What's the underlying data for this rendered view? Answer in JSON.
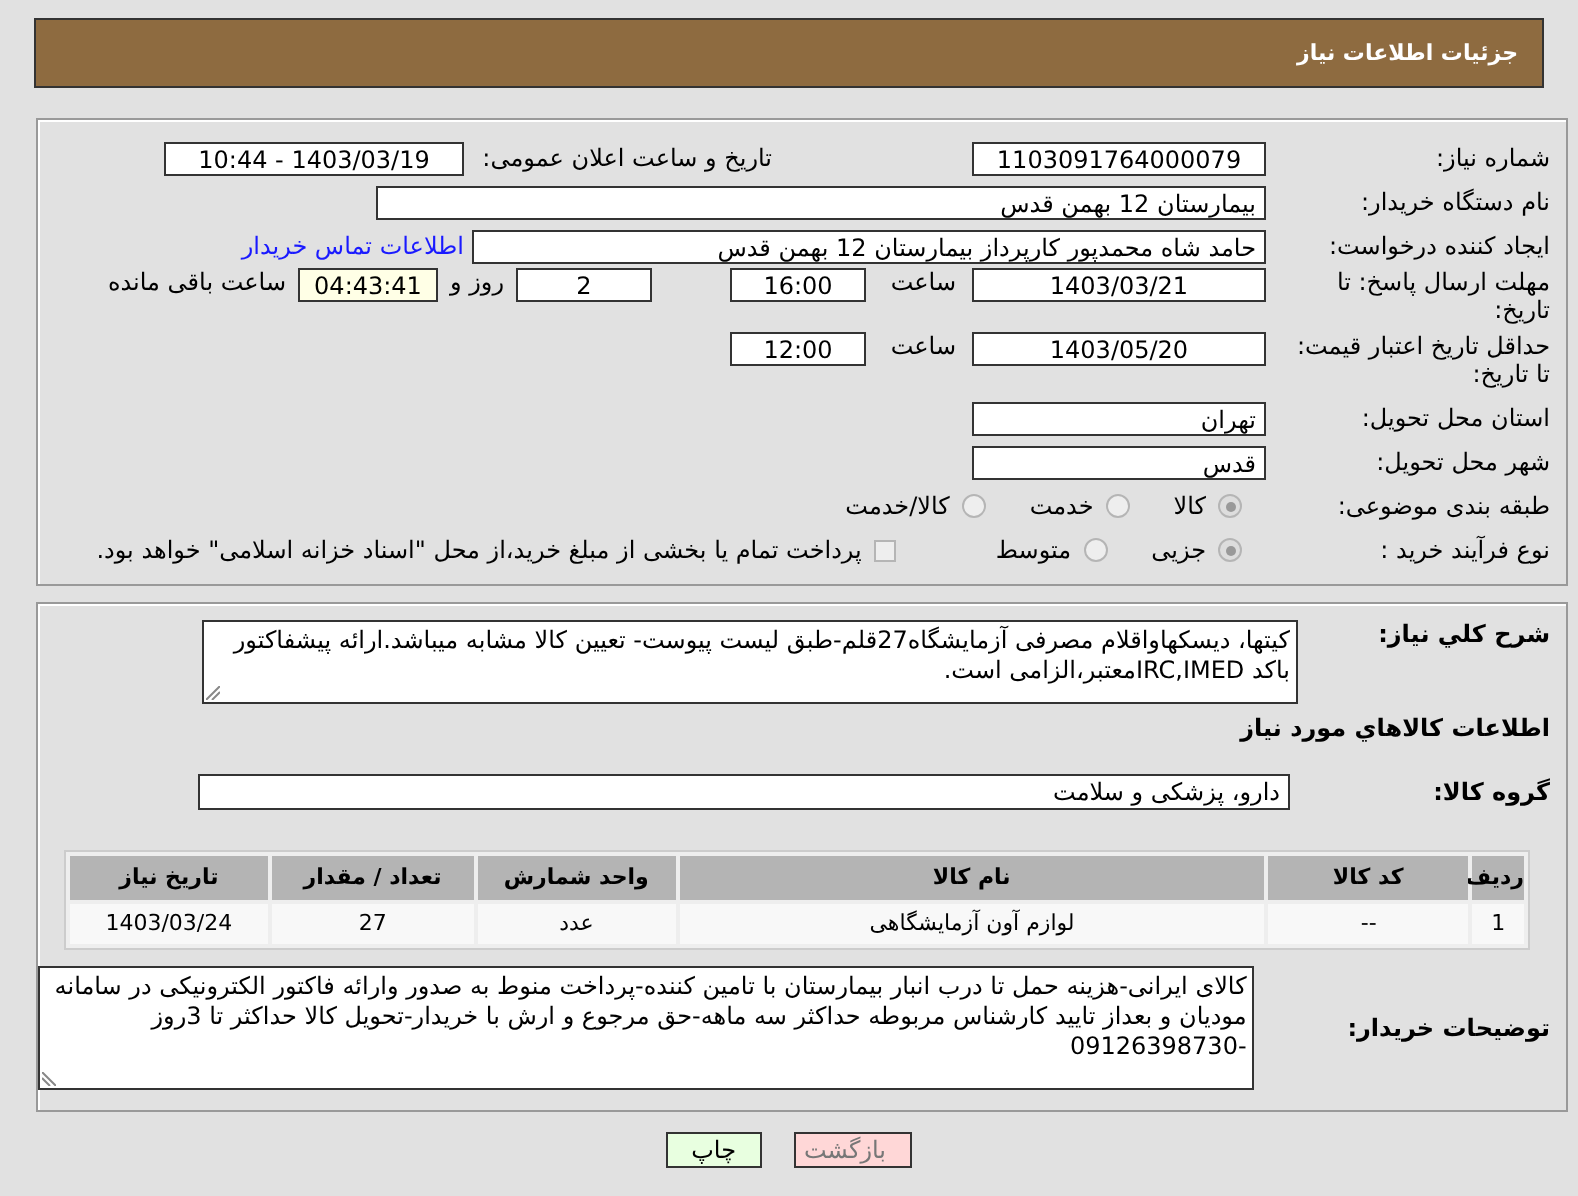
{
  "header": {
    "title": "جزئیات اطلاعات نیاز"
  },
  "need_number": {
    "label": "شماره نیاز:",
    "value": "1103091764000079"
  },
  "announce": {
    "label": "تاریخ و ساعت اعلان عمومی:",
    "value": "1403/03/19 - 10:44"
  },
  "buyer_org": {
    "label": "نام دستگاه خریدار:",
    "value": "بیمارستان 12 بهمن قدس"
  },
  "requester": {
    "label": "ایجاد کننده درخواست:",
    "value": "حامد شاه محمدپور کارپرداز بیمارستان 12 بهمن قدس",
    "link": "اطلاعات تماس خریدار"
  },
  "response_deadline": {
    "label": "مهلت ارسال پاسخ: تا تاریخ:",
    "date": "1403/03/21",
    "time_label": "ساعت",
    "time": "16:00",
    "days": "2",
    "days_label": "روز و",
    "remaining": "04:43:41",
    "remaining_label": "ساعت باقی مانده"
  },
  "price_validity": {
    "label": "حداقل تاریخ اعتبار قیمت: تا تاریخ:",
    "date": "1403/05/20",
    "time_label": "ساعت",
    "time": "12:00"
  },
  "province": {
    "label": "استان محل تحویل:",
    "value": "تهران"
  },
  "city": {
    "label": "شهر محل تحویل:",
    "value": "قدس"
  },
  "category": {
    "label": "طبقه بندی موضوعی:",
    "options": [
      {
        "label": "کالا",
        "selected": true
      },
      {
        "label": "خدمت",
        "selected": false
      },
      {
        "label": "کالا/خدمت",
        "selected": false
      }
    ]
  },
  "process": {
    "label": "نوع فرآیند خرید :",
    "options": [
      {
        "label": "جزیی",
        "selected": true
      },
      {
        "label": "متوسط",
        "selected": false
      }
    ],
    "checkbox": {
      "label": "پرداخت تمام یا بخشی از مبلغ خرید،از محل \"اسناد خزانه اسلامی\" خواهد بود.",
      "checked": false
    }
  },
  "summary": {
    "label": "شرح کلي نیاز:",
    "value": "کیتها، دیسکهاواقلام مصرفی آزمایشگاه27قلم-طبق لیست پیوست- تعیین کالا مشابه میباشد.ارائه پیشفاکتور باکد IRC,IMEDمعتبر،الزامی است."
  },
  "items_title": "اطلاعات کالاهاي مورد نیاز",
  "goods_group": {
    "label": "گروه کالا:",
    "value": "دارو، پزشکی و سلامت"
  },
  "table": {
    "columns": [
      "ردیف",
      "کد کالا",
      "نام کالا",
      "واحد شمارش",
      "تعداد / مقدار",
      "تاریخ نیاز"
    ],
    "rows": [
      [
        "1",
        "--",
        "لوازم آون آزمایشگاهی",
        "عدد",
        "27",
        "1403/03/24"
      ]
    ]
  },
  "buyer_notes": {
    "label": "توضیحات خریدار:",
    "value": "کالای ایرانی-هزینه حمل تا درب  انبار بیمارستان با تامین کننده-پرداخت منوط به صدور وارائه فاکتور الکترونیکی در سامانه مودیان و بعداز تایید کارشناس مربوطه حداکثر سه ماهه-حق مرجوع و ارش با خریدار-تحویل کالا حداکثر تا 3روز -09126398730"
  },
  "buttons": [
    {
      "label": "بازگشت",
      "kind": "back"
    },
    {
      "label": "چاپ",
      "kind": "print"
    }
  ]
}
